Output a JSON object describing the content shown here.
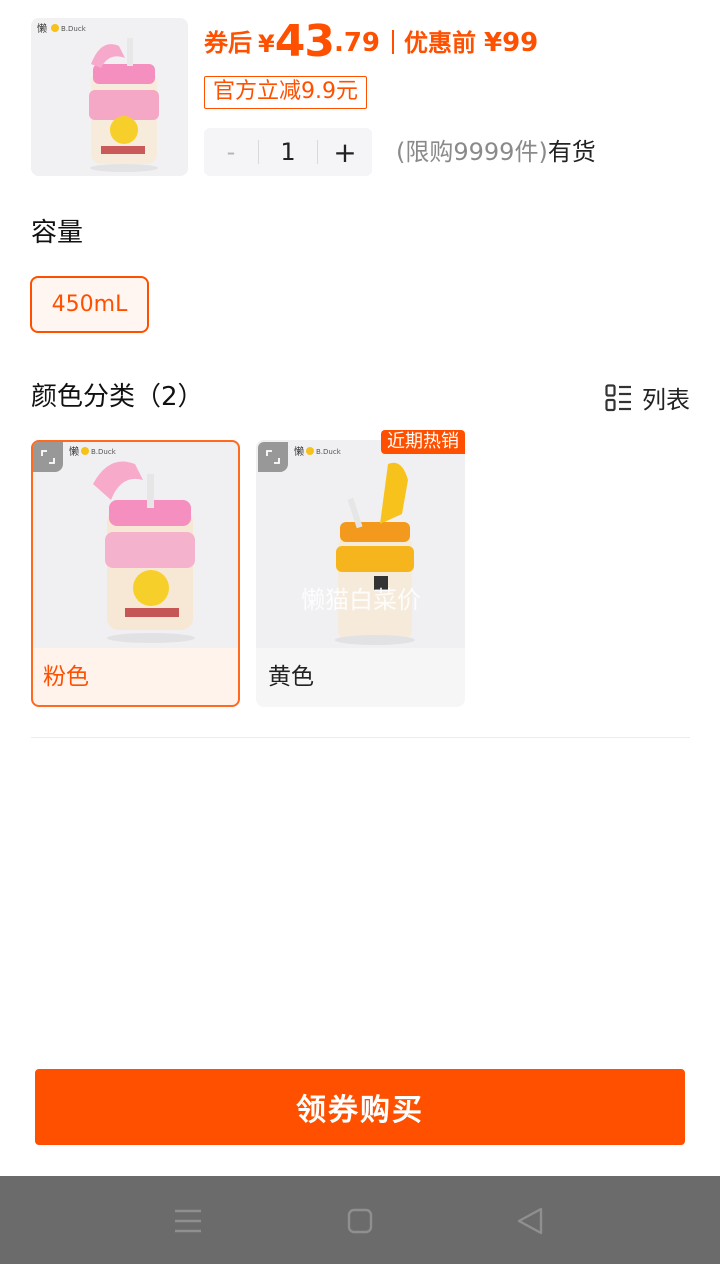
{
  "product": {
    "price_prefix": "券后",
    "currency": "¥",
    "price_int": "43",
    "price_dec": ".79",
    "orig_label": "优惠前",
    "orig_price": "¥99",
    "discount_tag": "官方立减9.9元",
    "quantity": "1",
    "minus_label": "-",
    "plus_label": "+",
    "limit_text": "(限购9999件)",
    "stock_text": "有货"
  },
  "capacity": {
    "title": "容量",
    "options": [
      {
        "label": "450mL",
        "selected": true
      }
    ]
  },
  "color": {
    "title": "颜色分类（2）",
    "view_toggle": "列表",
    "options": [
      {
        "label": "粉色",
        "selected": true,
        "tag": ""
      },
      {
        "label": "黄色",
        "selected": false,
        "tag": "近期热销",
        "watermark": "懒猫白菜价"
      }
    ]
  },
  "buy_button": "领券购买",
  "colors": {
    "accent": "#ff5000",
    "nav_bar": "#6b6b6b"
  },
  "nav": {
    "icons": [
      "menu-icon",
      "home-square-icon",
      "back-triangle-icon"
    ]
  }
}
